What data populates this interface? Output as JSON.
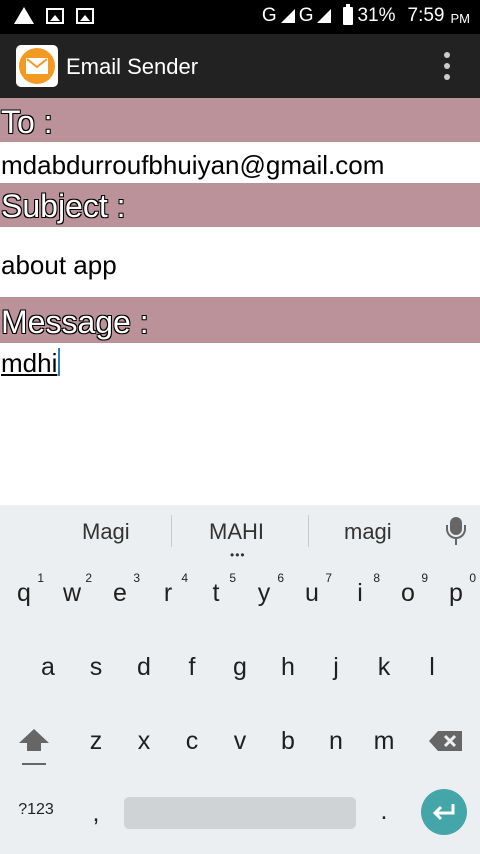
{
  "status_bar": {
    "network_1": "G",
    "network_2": "G",
    "battery": "31%",
    "time": "7:59",
    "ampm": "PM"
  },
  "app_bar": {
    "title": "Email Sender",
    "logo_icon": "envelope-icon",
    "menu_icon": "overflow-menu-icon"
  },
  "form": {
    "to_label": "To :",
    "to_value": "mdabdurroufbhuiyan@gmail.com",
    "subject_label": "Subject :",
    "subject_value": "about app",
    "message_label": "Message :",
    "message_value": "mdhi"
  },
  "keyboard": {
    "suggestions": [
      "Magi",
      "MAHI",
      "magi"
    ],
    "row1": [
      {
        "k": "q",
        "h": "1"
      },
      {
        "k": "w",
        "h": "2"
      },
      {
        "k": "e",
        "h": "3"
      },
      {
        "k": "r",
        "h": "4"
      },
      {
        "k": "t",
        "h": "5"
      },
      {
        "k": "y",
        "h": "6"
      },
      {
        "k": "u",
        "h": "7"
      },
      {
        "k": "i",
        "h": "8"
      },
      {
        "k": "o",
        "h": "9"
      },
      {
        "k": "p",
        "h": "0"
      }
    ],
    "row2": [
      "a",
      "s",
      "d",
      "f",
      "g",
      "h",
      "j",
      "k",
      "l"
    ],
    "row3": [
      "z",
      "x",
      "c",
      "v",
      "b",
      "n",
      "m"
    ],
    "symbols_label": "?123",
    "comma": ",",
    "period": ".",
    "colors": {
      "band": "#bc929a",
      "enter": "#44a6a8",
      "app_bar": "#222222",
      "logo": "#f29a21"
    }
  }
}
